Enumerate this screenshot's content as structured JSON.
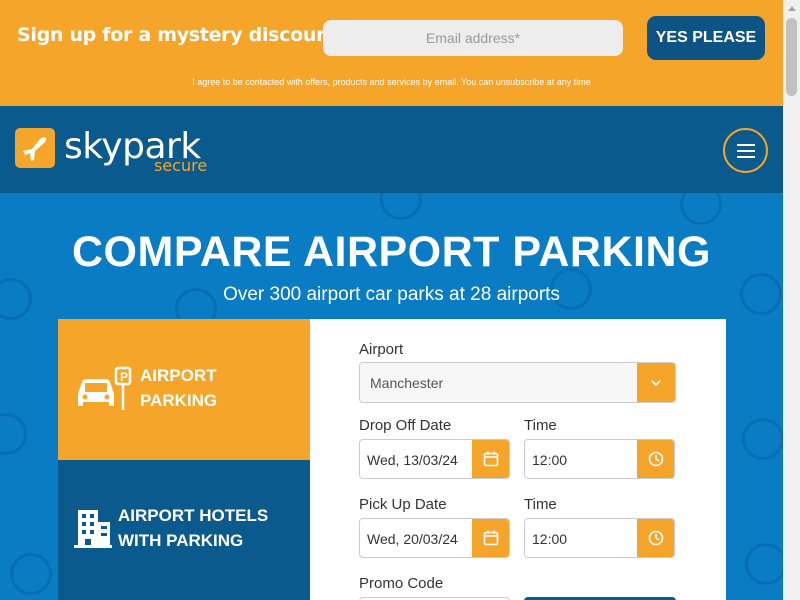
{
  "promo": {
    "headline": "Sign up for a mystery discount!",
    "email_placeholder": "Email address*",
    "cta_label": "YES PLEASE",
    "consent": "I agree to be contacted with offers, products and services by email. You can unsubscribe at any time"
  },
  "header": {
    "logo_name": "skypark",
    "logo_sub": "secure",
    "menu_icon": "hamburger-icon"
  },
  "hero": {
    "title": "COMPARE AIRPORT PARKING",
    "subtitle": "Over 300 airport car parks at 28 airports"
  },
  "tabs": [
    {
      "label_line1": "AIRPORT",
      "label_line2": "PARKING",
      "icon": "car-parking-icon",
      "active": true
    },
    {
      "label_line1": "AIRPORT HOTELS",
      "label_line2": "WITH PARKING",
      "icon": "hotel-icon",
      "active": false
    }
  ],
  "form": {
    "airport_label": "Airport",
    "airport_value": "Manchester",
    "dropoff_label": "Drop Off Date",
    "dropoff_value": "Wed, 13/03/24",
    "dropoff_time_label": "Time",
    "dropoff_time_value": "12:00",
    "pickup_label": "Pick Up Date",
    "pickup_value": "Wed, 20/03/24",
    "pickup_time_label": "Time",
    "pickup_time_value": "12:00",
    "promo_label": "Promo Code"
  },
  "colors": {
    "accent_orange": "#f5a52a",
    "navy": "#0b5a8e",
    "hero_blue": "#0a7cc4"
  }
}
